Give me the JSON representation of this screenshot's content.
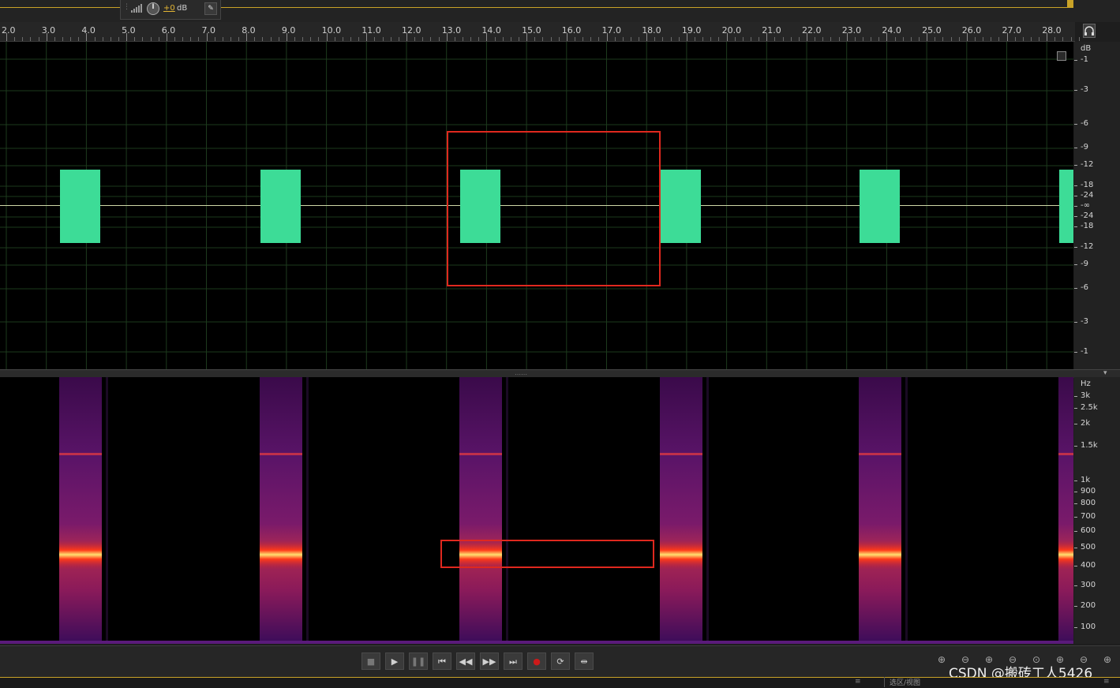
{
  "toolbar": {
    "volume_value": "+0",
    "volume_unit": "dB"
  },
  "ruler": {
    "ticks": [
      "2.0",
      "3.0",
      "4.0",
      "5.0",
      "6.0",
      "7.0",
      "8.0",
      "9.0",
      "10.0",
      "11.0",
      "12.0",
      "13.0",
      "14.0",
      "15.0",
      "16.0",
      "17.0",
      "18.0",
      "19.0",
      "20.0",
      "21.0",
      "22.0",
      "23.0",
      "24.0",
      "25.0",
      "26.0",
      "27.0",
      "28.0"
    ]
  },
  "waveform": {
    "db_unit": "dB",
    "db_labels": [
      "-1",
      "-3",
      "-6",
      "-9",
      "-12",
      "-18",
      "-24",
      "-∞",
      "-24",
      "-18",
      "-12",
      "-9",
      "-6",
      "-3",
      "-1"
    ],
    "color": "#3ddc97"
  },
  "spectrogram": {
    "hz_unit": "Hz",
    "hz_labels": [
      "3k",
      "2.5k",
      "2k",
      "1.5k",
      "1k",
      "900",
      "800",
      "700",
      "600",
      "500",
      "400",
      "300",
      "200",
      "100"
    ]
  },
  "colors": {
    "accent": "#c9a227",
    "selection": "#e0281e",
    "record": "#cc1a1a"
  },
  "transport": {
    "buttons": [
      {
        "name": "stop-button",
        "glyph": "■"
      },
      {
        "name": "play-button",
        "glyph": "▶"
      },
      {
        "name": "pause-button",
        "glyph": "❚❚"
      },
      {
        "name": "go-to-start-button",
        "glyph": "⏮"
      },
      {
        "name": "rewind-button",
        "glyph": "◀◀"
      },
      {
        "name": "fast-forward-button",
        "glyph": "▶▶"
      },
      {
        "name": "go-to-end-button",
        "glyph": "⏭"
      },
      {
        "name": "record-button",
        "glyph": "●"
      },
      {
        "name": "loop-button",
        "glyph": "⟳"
      },
      {
        "name": "skip-selection-button",
        "glyph": "⇹"
      }
    ]
  },
  "watermark": {
    "text": "CSDN @搬砖工人5426"
  },
  "statusbar": {
    "view_label": "选区/视图"
  }
}
